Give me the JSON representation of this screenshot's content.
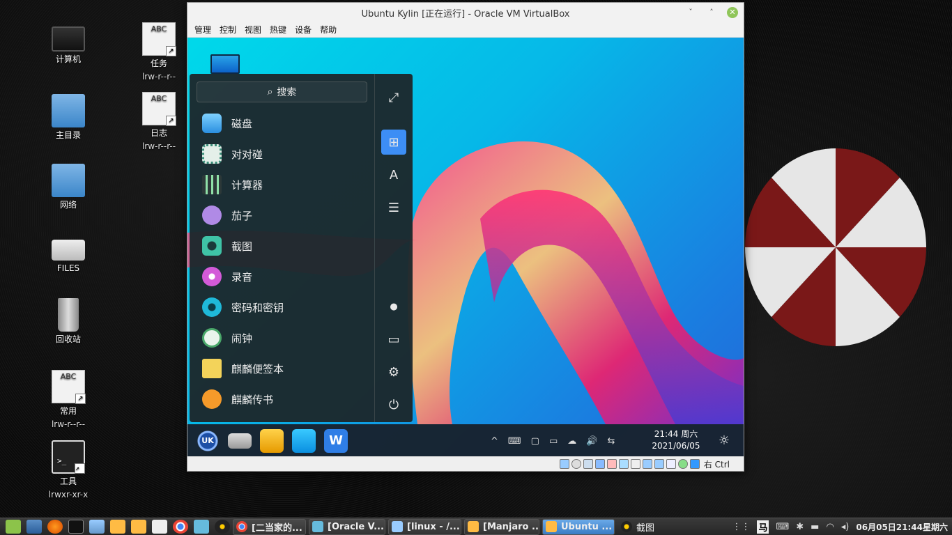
{
  "host_desktop": {
    "icons": [
      {
        "label": "计算机",
        "sub": ""
      },
      {
        "label": "主目录",
        "sub": ""
      },
      {
        "label": "网络",
        "sub": ""
      },
      {
        "label": "FILES",
        "sub": ""
      },
      {
        "label": "回收站",
        "sub": ""
      },
      {
        "label": "常用",
        "sub": "lrw-r--r--",
        "doc_text": "ABC"
      },
      {
        "label": "工具",
        "sub": "lrwxr-xr-x",
        "term_text": ">_"
      },
      {
        "label": "任务",
        "sub": "lrw-r--r--",
        "doc_text": "ABC"
      },
      {
        "label": "日志",
        "sub": "lrw-r--r--",
        "doc_text": "ABC"
      }
    ]
  },
  "vbox": {
    "title": "Ubuntu Kylin [正在运行] - Oracle VM VirtualBox",
    "controls": {
      "minimize": "ˇ",
      "restore": "˄",
      "close": "✕"
    },
    "menu": [
      "管理",
      "控制",
      "视图",
      "热键",
      "设备",
      "帮助"
    ],
    "status_host_key": "右 Ctrl"
  },
  "guest": {
    "start_menu": {
      "search_placeholder": "搜索",
      "search_icon": "⌕",
      "apps": [
        {
          "label": "磁盘",
          "icon": "disk-icon",
          "color": "#4fb3f0"
        },
        {
          "label": "对对碰",
          "icon": "game-icon",
          "color": "#d9e8e2"
        },
        {
          "label": "计算器",
          "icon": "calculator-icon",
          "color": "#3c4a4a"
        },
        {
          "label": "茄子",
          "icon": "cheese-icon",
          "color": "#b08ae6"
        },
        {
          "label": "截图",
          "icon": "screenshot-icon",
          "color": "#3fc3a6"
        },
        {
          "label": "录音",
          "icon": "microphone-icon",
          "color": "#d35ad8"
        },
        {
          "label": "密码和密钥",
          "icon": "lock-icon",
          "color": "#1fb9d9"
        },
        {
          "label": "闹钟",
          "icon": "clock-icon",
          "color": "#eaf4ec"
        },
        {
          "label": "麒麟便签本",
          "icon": "note-icon",
          "color": "#f3d35a"
        },
        {
          "label": "麒麟传书",
          "icon": "send-icon",
          "color": "#f59a2a"
        }
      ],
      "side": {
        "expand": "⤢",
        "all_apps": "⊞",
        "letter": "A",
        "category": "☰",
        "user": "●",
        "computer": "▭",
        "settings": "⚙",
        "power": "⏻"
      }
    },
    "panel": {
      "clock_time": "21:44 周六",
      "clock_date": "2021/06/05",
      "tray": [
        "^",
        "⌨",
        "▢",
        "▭",
        "☁",
        "🔊",
        "⇆"
      ],
      "theme_icon": "☼",
      "start_label": "UK"
    }
  },
  "host_taskbar": {
    "windows": [
      {
        "label": "[二当家的...",
        "color": "#e44"
      },
      {
        "label": "[Oracle V...",
        "color": "#6bd"
      },
      {
        "label": "[linux - /...",
        "color": "#9cf"
      },
      {
        "label": "[Manjaro ...",
        "color": "#fb4"
      },
      {
        "label": "Ubuntu ...",
        "color": "#fb4"
      },
      {
        "label": "截图",
        "color": "#555"
      }
    ],
    "clock": "06月05日21:44星期六",
    "input_method": "马"
  },
  "colors": {
    "accent": "#3d8ef5",
    "menu_bg": "#1c282c",
    "taskbar": "#2e2e2e"
  }
}
